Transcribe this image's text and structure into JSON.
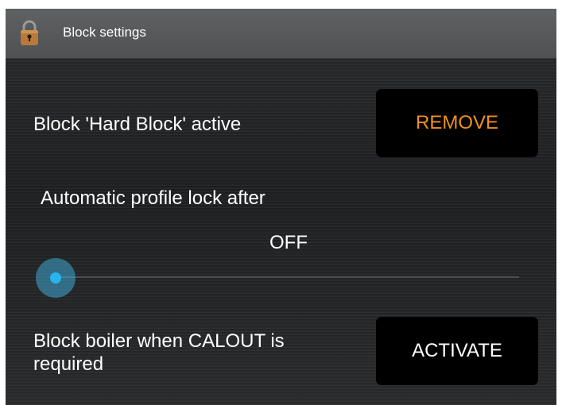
{
  "header": {
    "title": "Block settings",
    "icon": "lock-icon"
  },
  "hard_block": {
    "label": "Block 'Hard Block' active",
    "button_label": "REMOVE",
    "button_color": "#f0901c"
  },
  "auto_lock": {
    "label": "Automatic profile lock after",
    "value": "OFF",
    "slider_level": 0
  },
  "calout": {
    "label_line1": "Block boiler when CALOUT is",
    "label_line2": "required",
    "button_label": "ACTIVATE"
  },
  "colors": {
    "accent": "#29b4ee",
    "header_bg": "#555759",
    "background": "#232527"
  }
}
